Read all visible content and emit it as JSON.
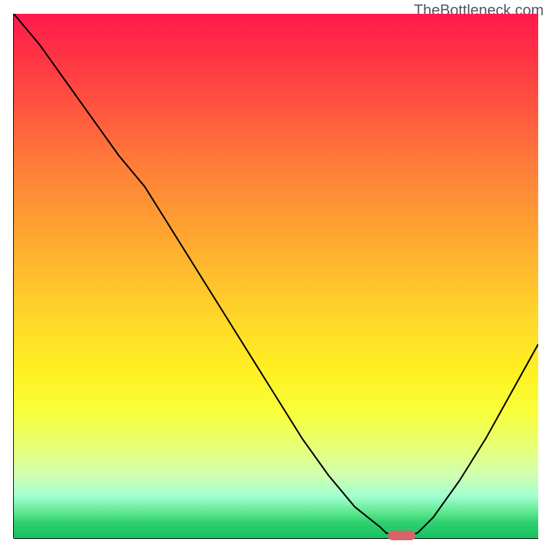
{
  "watermark": "TheBottleneck.com",
  "chart_data": {
    "type": "line",
    "title": "",
    "xlabel": "",
    "ylabel": "",
    "xlim": [
      0,
      100
    ],
    "ylim": [
      0,
      100
    ],
    "x": [
      0,
      5,
      10,
      15,
      20,
      25,
      30,
      35,
      40,
      45,
      50,
      55,
      60,
      65,
      70,
      71,
      73,
      75,
      77,
      80,
      85,
      90,
      95,
      100
    ],
    "values": [
      100,
      94,
      87,
      80,
      73,
      67,
      59,
      51,
      43,
      35,
      27,
      19,
      12,
      6,
      2,
      1,
      0.5,
      0.5,
      1,
      4,
      11,
      19,
      28,
      37
    ],
    "curve_notes": "V-shaped bottleneck curve with minimum around x=73-75",
    "marker": {
      "x": 74,
      "y": 0.5,
      "color": "#d9636b"
    },
    "gradient_background": {
      "top_color": "#ff1a4d",
      "mid_color": "#ffd728",
      "bottom_color": "#18c060",
      "description": "red (bad) at top through orange/yellow to green (good) at bottom"
    }
  }
}
